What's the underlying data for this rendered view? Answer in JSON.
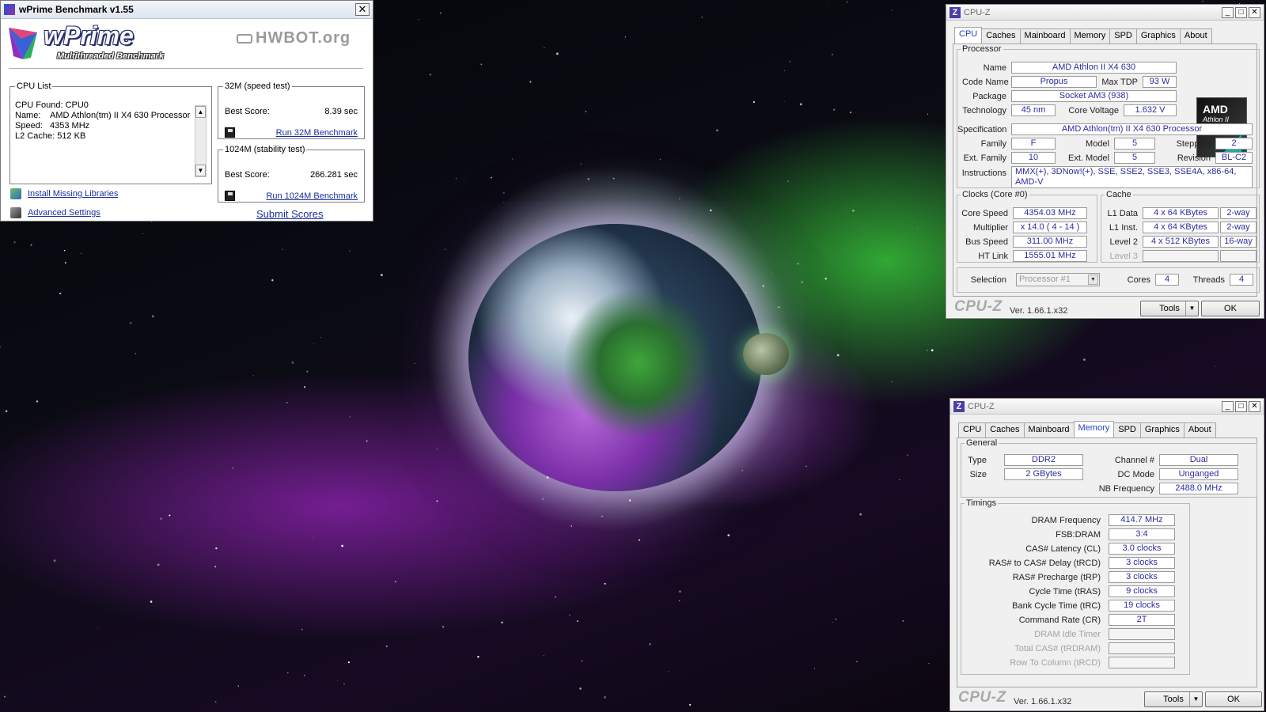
{
  "wprime": {
    "title": "wPrime Benchmark v1.55",
    "brand": "wPrime",
    "subtitle": "Multithreaded Benchmark",
    "hwbot": "HWBOT.org",
    "cpu_list_legend": "CPU List",
    "cpu_list_lines": [
      "CPU Found: CPU0",
      "Name:    AMD Athlon(tm) II X4 630 Processor",
      "Speed:   4353 MHz",
      "L2 Cache: 512 KB"
    ],
    "test32": {
      "legend": "32M (speed test)",
      "best_label": "Best Score:",
      "best_value": "8.39 sec",
      "run_label": "Run 32M Benchmark"
    },
    "test1024": {
      "legend": "1024M (stability test)",
      "best_label": "Best Score:",
      "best_value": "266.281 sec",
      "run_label": "Run 1024M Benchmark"
    },
    "install_libs": "Install Missing Libraries",
    "advanced_settings": "Advanced Settings",
    "submit_scores": "Submit Scores"
  },
  "cpuz_cpu": {
    "title": "CPU-Z",
    "tabs": [
      "CPU",
      "Caches",
      "Mainboard",
      "Memory",
      "SPD",
      "Graphics",
      "About"
    ],
    "active_tab": "CPU",
    "processor_legend": "Processor",
    "name_label": "Name",
    "name_value": "AMD Athlon II X4 630",
    "codename_label": "Code Name",
    "codename_value": "Propus",
    "maxtdp_label": "Max TDP",
    "maxtdp_value": "93 W",
    "package_label": "Package",
    "package_value": "Socket AM3 (938)",
    "technology_label": "Technology",
    "technology_value": "45 nm",
    "corevoltage_label": "Core Voltage",
    "corevoltage_value": "1.632 V",
    "specification_label": "Specification",
    "specification_value": "AMD Athlon(tm) II X4 630 Processor",
    "family_label": "Family",
    "family_value": "F",
    "model_label": "Model",
    "model_value": "5",
    "stepping_label": "Stepping",
    "stepping_value": "2",
    "extfamily_label": "Ext. Family",
    "extfamily_value": "10",
    "extmodel_label": "Ext. Model",
    "extmodel_value": "5",
    "revision_label": "Revision",
    "revision_value": "BL-C2",
    "instructions_label": "Instructions",
    "instructions_value": "MMX(+), 3DNow!(+), SSE, SSE2, SSE3, SSE4A, x86-64, AMD-V",
    "logo_line1": "AMD",
    "logo_line2": "Athlon II",
    "clocks_legend": "Clocks (Core #0)",
    "corespeed_label": "Core Speed",
    "corespeed_value": "4354.03 MHz",
    "multiplier_label": "Multiplier",
    "multiplier_value": "x 14.0 ( 4 - 14 )",
    "busspeed_label": "Bus Speed",
    "busspeed_value": "311.00 MHz",
    "htlink_label": "HT Link",
    "htlink_value": "1555.01 MHz",
    "cache_legend": "Cache",
    "l1data_label": "L1 Data",
    "l1data_value": "4 x 64 KBytes",
    "l1data_way": "2-way",
    "l1inst_label": "L1 Inst.",
    "l1inst_value": "4 x 64 KBytes",
    "l1inst_way": "2-way",
    "level2_label": "Level 2",
    "level2_value": "4 x 512 KBytes",
    "level2_way": "16-way",
    "level3_label": "Level 3",
    "selection_label": "Selection",
    "selection_value": "Processor #1",
    "cores_label": "Cores",
    "cores_value": "4",
    "threads_label": "Threads",
    "threads_value": "4",
    "footer_brand": "CPU-Z",
    "version": "Ver. 1.66.1.x32",
    "tools_label": "Tools",
    "ok_label": "OK"
  },
  "cpuz_mem": {
    "title": "CPU-Z",
    "tabs": [
      "CPU",
      "Caches",
      "Mainboard",
      "Memory",
      "SPD",
      "Graphics",
      "About"
    ],
    "active_tab": "Memory",
    "general_legend": "General",
    "type_label": "Type",
    "type_value": "DDR2",
    "size_label": "Size",
    "size_value": "2 GBytes",
    "channel_label": "Channel #",
    "channel_value": "Dual",
    "dcmode_label": "DC Mode",
    "dcmode_value": "Unganged",
    "nbfreq_label": "NB Frequency",
    "nbfreq_value": "2488.0 MHz",
    "timings_legend": "Timings",
    "timings": [
      {
        "label": "DRAM Frequency",
        "value": "414.7 MHz",
        "dim": false
      },
      {
        "label": "FSB:DRAM",
        "value": "3:4",
        "dim": false
      },
      {
        "label": "CAS# Latency (CL)",
        "value": "3.0 clocks",
        "dim": false
      },
      {
        "label": "RAS# to CAS# Delay (tRCD)",
        "value": "3 clocks",
        "dim": false
      },
      {
        "label": "RAS# Precharge (tRP)",
        "value": "3 clocks",
        "dim": false
      },
      {
        "label": "Cycle Time (tRAS)",
        "value": "9 clocks",
        "dim": false
      },
      {
        "label": "Bank Cycle Time (tRC)",
        "value": "19 clocks",
        "dim": false
      },
      {
        "label": "Command Rate (CR)",
        "value": "2T",
        "dim": false
      },
      {
        "label": "DRAM Idle Timer",
        "value": "",
        "dim": true
      },
      {
        "label": "Total CAS# (tRDRAM)",
        "value": "",
        "dim": true
      },
      {
        "label": "Row To Column (tRCD)",
        "value": "",
        "dim": true
      }
    ],
    "footer_brand": "CPU-Z",
    "version": "Ver. 1.66.1.x32",
    "tools_label": "Tools",
    "ok_label": "OK"
  },
  "colors": {
    "value_text": "#2c2ca0",
    "active_tab_text": "#2642c4",
    "link": "#1a2f9c"
  }
}
